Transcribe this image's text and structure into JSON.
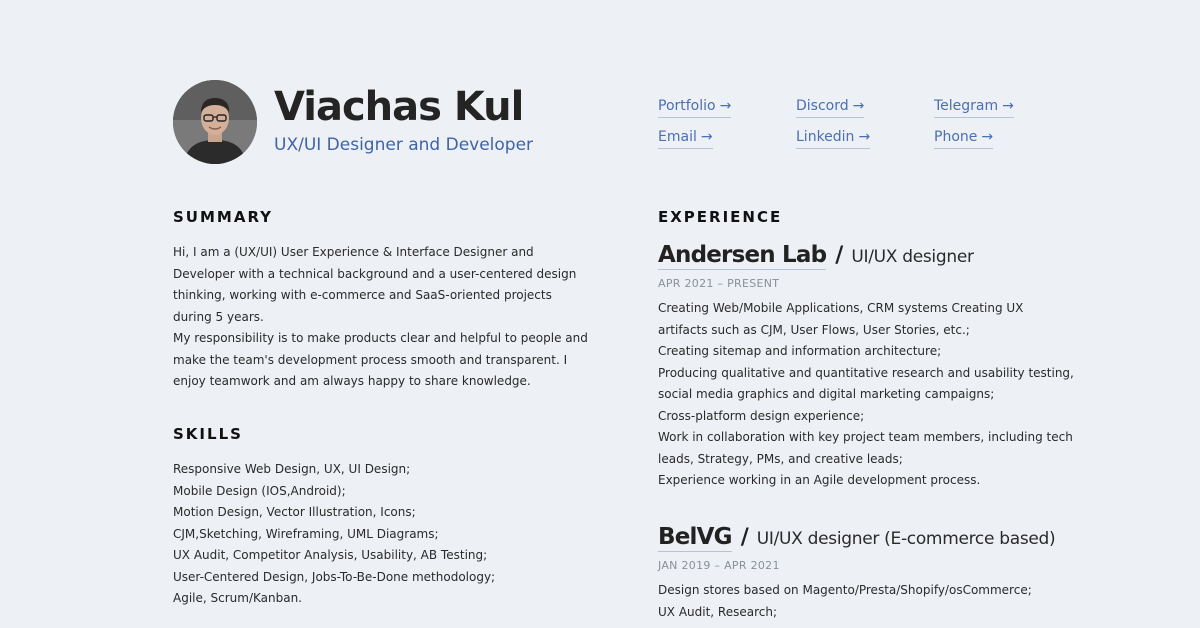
{
  "profile": {
    "name": "Viachas Kul",
    "title": "UX/UI Designer and Developer"
  },
  "contacts": [
    {
      "label": "Portfolio",
      "arrow": "→"
    },
    {
      "label": "Discord",
      "arrow": "→"
    },
    {
      "label": "Telegram",
      "arrow": "→"
    },
    {
      "label": "Email",
      "arrow": "→"
    },
    {
      "label": "Linkedin",
      "arrow": "→"
    },
    {
      "label": "Phone",
      "arrow": "→"
    }
  ],
  "summary": {
    "title": "SUMMARY",
    "lines": [
      "Hi, I am a (UX/UI) User Experience & Interface Designer and",
      "Developer with a technical background and a user-centered design",
      "thinking, working with e-commerce and SaaS-oriented projects",
      "during 5 years.",
      "My responsibility is to make products clear and helpful to people and",
      "make the team's development process smooth and transparent. I",
      "enjoy teamwork and am always happy to share knowledge."
    ]
  },
  "skills": {
    "title": "SKILLS",
    "lines": [
      "Responsive Web Design, UX, UI Design;",
      "Mobile Design (IOS,Android);",
      "Motion Design, Vector Illustration, Icons;",
      "CJM,Sketching, Wireframing, UML Diagrams;",
      "UX Audit, Competitor Analysis, Usability, AB Testing;",
      "User-Centered Design, Jobs-To-Be-Done methodology;",
      "Agile, Scrum/Kanban."
    ]
  },
  "experience": {
    "title": "EXPERIENCE",
    "jobs": [
      {
        "company": "Andersen Lab",
        "separator": "/",
        "position": "UI/UX designer",
        "dates": "APR 2021 – PRESENT",
        "lines": [
          "Creating Web/Mobile Applications, CRM systems Creating UX",
          "artifacts such as CJM, User Flows, User Stories, etc.;",
          "Creating sitemap and information architecture;",
          "Producing qualitative and quantitative research and usability testing,",
          "social media graphics and digital marketing campaigns;",
          "Cross-platform design experience;",
          "Work in collaboration with key project team members, including tech",
          "leads, Strategy, PMs, and creative leads;",
          "Experience working in an Agile development process."
        ]
      },
      {
        "company": "BelVG",
        "separator": "/",
        "position": "UI/UX designer (E-commerce based)",
        "dates": "JAN 2019 – APR 2021",
        "lines": [
          "Design stores based on Magento/Presta/Shopify/osCommerce;",
          "UX Audit, Research;"
        ]
      }
    ]
  },
  "colors": {
    "background": "#edf0f5",
    "accent": "#3f64a6",
    "link": "#4a6fb2"
  },
  "icons": {
    "avatar": "profile-photo"
  }
}
